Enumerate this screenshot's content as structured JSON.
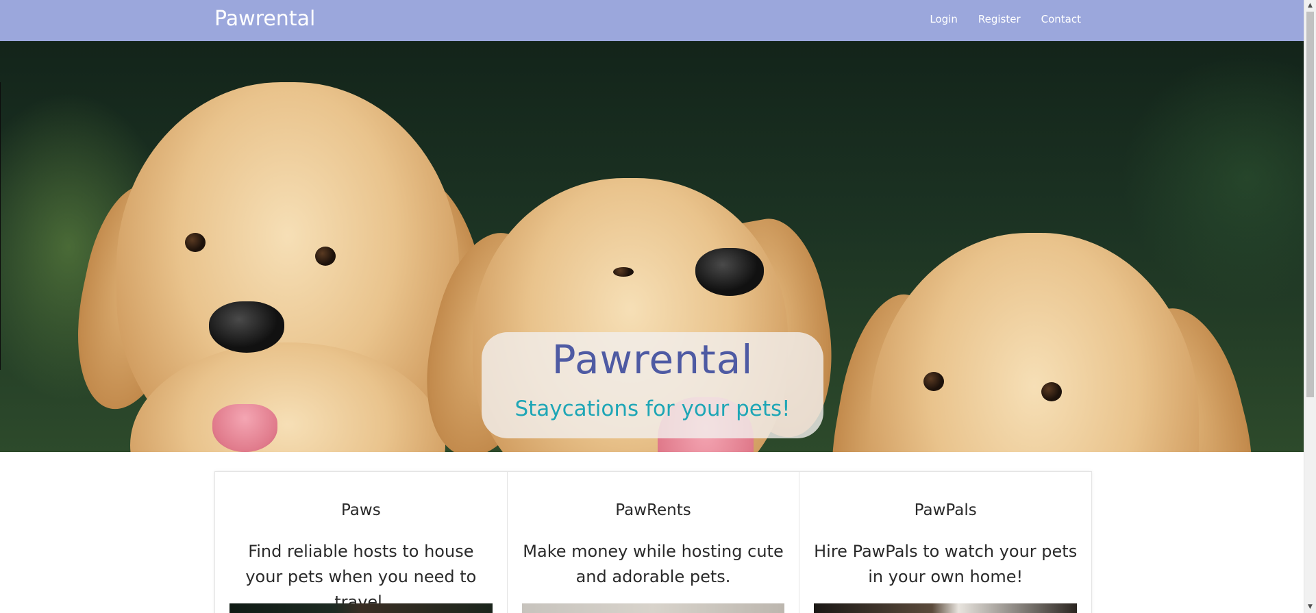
{
  "navbar": {
    "brand": "Pawrental",
    "links": [
      "Login",
      "Register",
      "Contact"
    ],
    "background_color": "#9ba7dc"
  },
  "hero": {
    "title": "Pawrental",
    "subtitle": "Staycations for your pets!",
    "title_color": "#4e5aa3",
    "subtitle_color": "#1ea6b6",
    "carousel": {
      "slide_count": 5,
      "active_index": 1
    }
  },
  "cards": [
    {
      "title": "Paws",
      "text": "Find reliable hosts to house your pets when you need to travel."
    },
    {
      "title": "PawRents",
      "text": "Make money while hosting cute and adorable pets."
    },
    {
      "title": "PawPals",
      "text": "Hire PawPals to watch your pets in your own home!"
    }
  ],
  "scrollbar": {
    "up_icon": "chevron-up-icon",
    "down_icon": "chevron-down-icon"
  }
}
